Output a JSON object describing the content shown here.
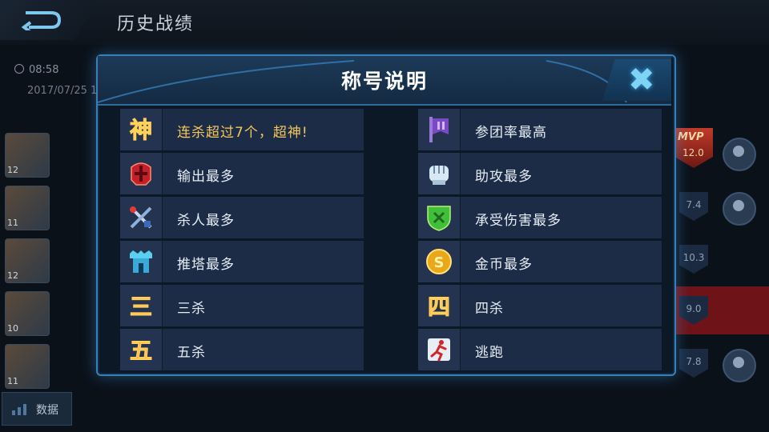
{
  "page": {
    "title": "历史战绩",
    "time": "08:58",
    "date": "2017/07/25 1",
    "data_button": "数据",
    "hero_levels": [
      "12",
      "11",
      "12",
      "10",
      "11"
    ],
    "scores": [
      "7.4",
      "10.3",
      "9.0",
      "7.8"
    ],
    "mvp": {
      "label": "MVP",
      "score": "12.0"
    }
  },
  "modal": {
    "title": "称号说明",
    "close_icon": "close-x-icon",
    "left": [
      {
        "icon": "shen-godlike-icon",
        "label": "连杀超过7个，超神!",
        "highlight": true
      },
      {
        "icon": "red-helmet-icon",
        "label": "输出最多"
      },
      {
        "icon": "crossed-swords-icon",
        "label": "杀人最多"
      },
      {
        "icon": "tower-icon",
        "label": "推塔最多"
      },
      {
        "icon": "san-triple-kill-icon",
        "label": "三杀"
      },
      {
        "icon": "wu-penta-kill-icon",
        "label": "五杀"
      }
    ],
    "right": [
      {
        "icon": "purple-banner-icon",
        "label": "参团率最高"
      },
      {
        "icon": "fist-icon",
        "label": "助攻最多"
      },
      {
        "icon": "green-shield-icon",
        "label": "承受伤害最多"
      },
      {
        "icon": "gold-coin-icon",
        "label": "金币最多"
      },
      {
        "icon": "si-quadra-kill-icon",
        "label": "四杀"
      },
      {
        "icon": "running-man-icon",
        "label": "逃跑"
      }
    ]
  },
  "colors": {
    "modal_border": "#3b7fb7",
    "row_bg": "#1d2c46",
    "highlight_text": "#f4c75c"
  }
}
